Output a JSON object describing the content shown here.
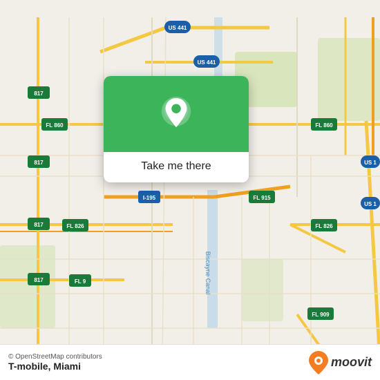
{
  "map": {
    "attribution": "© OpenStreetMap contributors",
    "bg_color": "#f2efe9"
  },
  "popup": {
    "label": "Take me there",
    "green_color": "#3cb55a"
  },
  "bottom_bar": {
    "attribution": "© OpenStreetMap contributors",
    "location": "T-mobile, Miami",
    "moovit_label": "moovit"
  }
}
